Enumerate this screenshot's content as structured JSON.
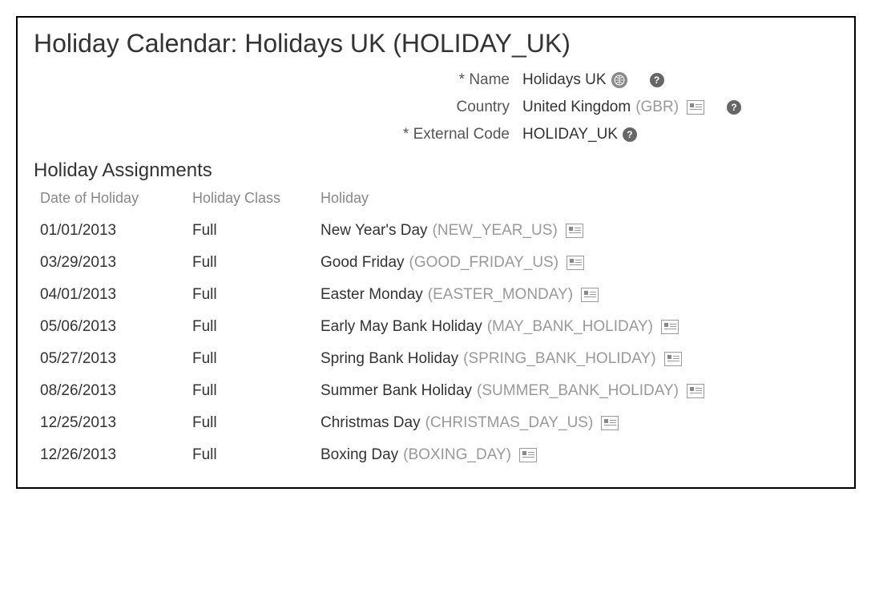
{
  "header": {
    "title": "Holiday Calendar: Holidays UK (HOLIDAY_UK)",
    "fields": {
      "name": {
        "label": "* Name",
        "value": "Holidays UK"
      },
      "country": {
        "label": "Country",
        "value": "United Kingdom",
        "code": "(GBR)"
      },
      "external_code": {
        "label": "* External Code",
        "value": "HOLIDAY_UK"
      }
    }
  },
  "assignments": {
    "title": "Holiday Assignments",
    "columns": {
      "date": "Date of Holiday",
      "class": "Holiday Class",
      "holiday": "Holiday"
    },
    "rows": [
      {
        "date": "01/01/2013",
        "class": "Full",
        "name": "New Year's Day",
        "code": "(NEW_YEAR_US)"
      },
      {
        "date": "03/29/2013",
        "class": "Full",
        "name": "Good Friday",
        "code": "(GOOD_FRIDAY_US)"
      },
      {
        "date": "04/01/2013",
        "class": "Full",
        "name": "Easter Monday",
        "code": "(EASTER_MONDAY)"
      },
      {
        "date": "05/06/2013",
        "class": "Full",
        "name": "Early May Bank Holiday",
        "code": "(MAY_BANK_HOLIDAY)"
      },
      {
        "date": "05/27/2013",
        "class": "Full",
        "name": "Spring Bank Holiday",
        "code": "(SPRING_BANK_HOLIDAY)"
      },
      {
        "date": "08/26/2013",
        "class": "Full",
        "name": "Summer Bank Holiday",
        "code": "(SUMMER_BANK_HOLIDAY)"
      },
      {
        "date": "12/25/2013",
        "class": "Full",
        "name": "Christmas Day",
        "code": "(CHRISTMAS_DAY_US)"
      },
      {
        "date": "12/26/2013",
        "class": "Full",
        "name": "Boxing Day",
        "code": "(BOXING_DAY)"
      }
    ]
  }
}
